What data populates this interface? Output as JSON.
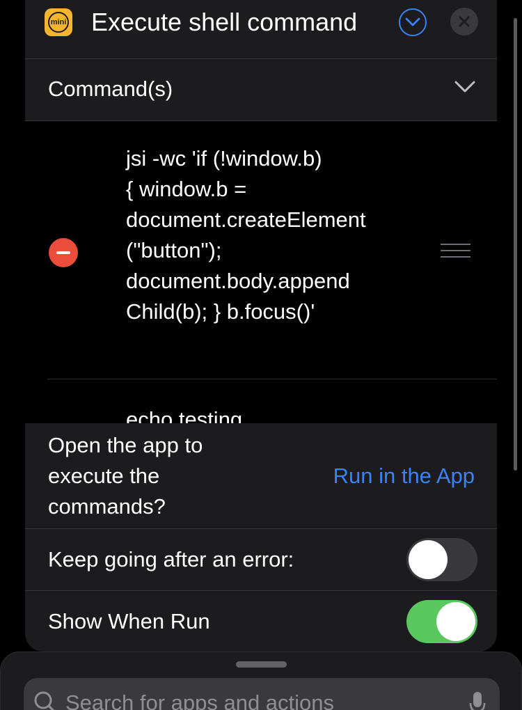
{
  "header": {
    "app_icon_text": "mini",
    "title": "Execute shell command"
  },
  "command_section": {
    "label": "Command(s)"
  },
  "commands": [
    {
      "text": "jsi -wc 'if (!window.b)\n{ window.b =\ndocument.createElement\n(\"button\");\ndocument.body.append\nChild(b); } b.focus()'"
    },
    {
      "text": "echo testing..."
    }
  ],
  "options": {
    "open_app_text": "Open the app to execute the commands?",
    "run_in_app_label": "Run in the App",
    "keep_going_label": "Keep going after an error:",
    "keep_going_value": false,
    "show_when_run_label": "Show When Run",
    "show_when_run_value": true
  },
  "search": {
    "placeholder": "Search for apps and actions"
  },
  "colors": {
    "accent": "#3b82f6",
    "toggle_on": "#5ac85f",
    "remove": "#eb4d3d",
    "app_icon": "#f5b52e"
  }
}
